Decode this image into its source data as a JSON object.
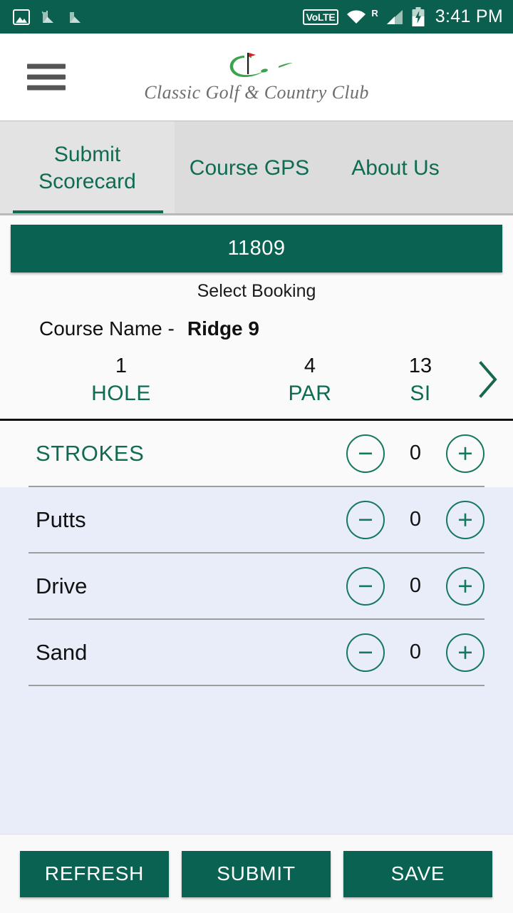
{
  "statusbar": {
    "icons_left": [
      "photo-icon",
      "nearby-n-icon",
      "nearby-n-icon-2"
    ],
    "volte_label": "VoLTE",
    "roaming_label": "R",
    "icons_right": [
      "wifi-icon",
      "roaming-icon",
      "signal-icon",
      "battery-charging-icon"
    ],
    "time": "3:41 PM",
    "bg_color": "#0a5f4e"
  },
  "header": {
    "menu_icon": "hamburger-menu-icon",
    "logo_name": "classic-golf-logo",
    "brand_text": "Classic Golf & Country Club",
    "logo_green": "#3ba34a",
    "flag_red": "#cc2127"
  },
  "tabs": {
    "items": [
      {
        "label": "Submit\nScorecard",
        "line1": "Submit",
        "line2": "Scorecard",
        "active": true
      },
      {
        "label": "Course GPS",
        "line1": "Course GPS",
        "line2": "",
        "active": false
      },
      {
        "label": "About Us",
        "line1": "About Us",
        "line2": "",
        "active": false
      }
    ],
    "accent_color": "#0f6b52",
    "bg_color": "#dcdcdc"
  },
  "booking": {
    "selected_booking_id": "11809",
    "select_label": "Select Booking",
    "course_label": "Course Name -",
    "course_value": "Ridge 9",
    "button_color": "#0a6352"
  },
  "hole_info": {
    "columns": [
      {
        "value": "1",
        "label": "HOLE"
      },
      {
        "value": "4",
        "label": "PAR"
      },
      {
        "value": "13",
        "label": "SI"
      }
    ],
    "next_icon": "chevron-right-icon"
  },
  "score_rows": [
    {
      "label": "STROKES",
      "value": "0",
      "highlight": true,
      "minus_icon": "minus-circle-icon",
      "plus_icon": "plus-circle-icon"
    },
    {
      "label": "Putts",
      "value": "0",
      "highlight": false,
      "minus_icon": "minus-circle-icon",
      "plus_icon": "plus-circle-icon"
    },
    {
      "label": "Drive",
      "value": "0",
      "highlight": false,
      "minus_icon": "minus-circle-icon",
      "plus_icon": "plus-circle-icon"
    },
    {
      "label": "Sand",
      "value": "0",
      "highlight": false,
      "minus_icon": "minus-circle-icon",
      "plus_icon": "plus-circle-icon"
    }
  ],
  "footer": {
    "buttons": [
      {
        "label": "REFRESH"
      },
      {
        "label": "SUBMIT"
      },
      {
        "label": "SAVE"
      }
    ]
  }
}
